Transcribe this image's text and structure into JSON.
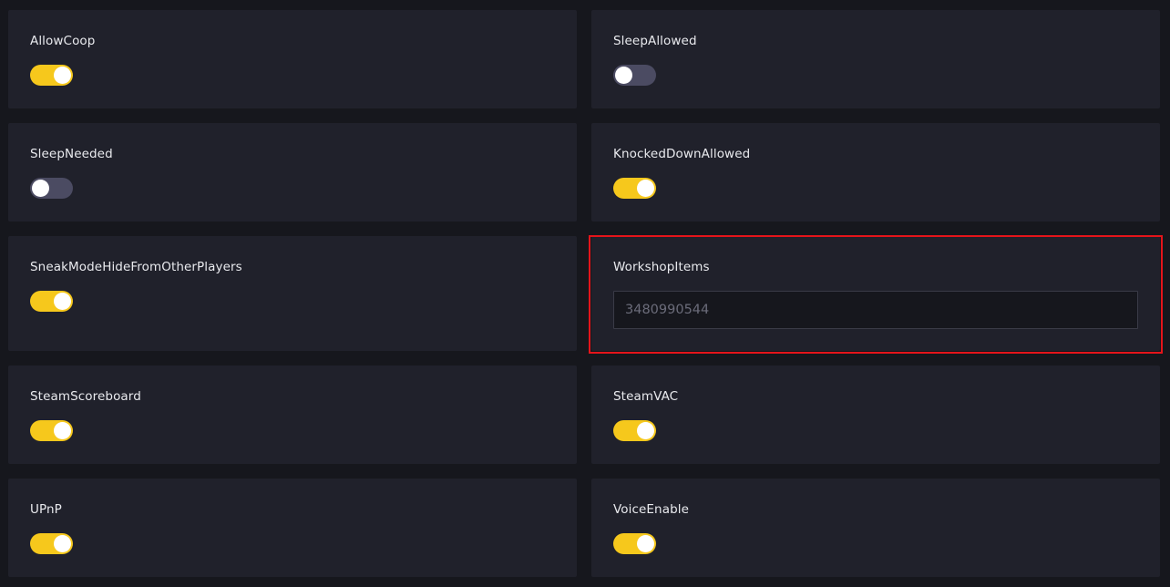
{
  "settings": {
    "allow_coop": {
      "label": "AllowCoop",
      "enabled": true
    },
    "sleep_allowed": {
      "label": "SleepAllowed",
      "enabled": false
    },
    "sleep_needed": {
      "label": "SleepNeeded",
      "enabled": false
    },
    "knocked_down_allowed": {
      "label": "KnockedDownAllowed",
      "enabled": true
    },
    "sneak_mode_hide": {
      "label": "SneakModeHideFromOtherPlayers",
      "enabled": true
    },
    "workshop_items": {
      "label": "WorkshopItems",
      "value": "3480990544"
    },
    "steam_scoreboard": {
      "label": "SteamScoreboard",
      "enabled": true
    },
    "steam_vac": {
      "label": "SteamVAC",
      "enabled": true
    },
    "upnp": {
      "label": "UPnP",
      "enabled": true
    },
    "voice_enable": {
      "label": "VoiceEnable",
      "enabled": true
    }
  },
  "colors": {
    "toggle_on": "#f6c81c",
    "toggle_off": "#4b4b62",
    "highlight": "#e5141a",
    "card_bg": "#20212b",
    "page_bg": "#16171d"
  }
}
